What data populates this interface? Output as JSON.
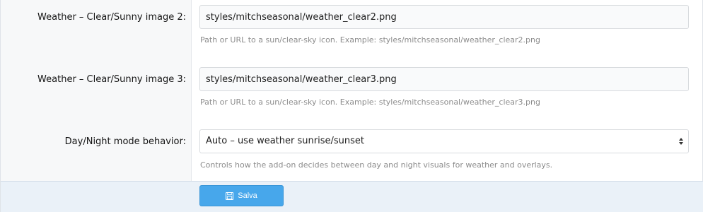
{
  "fields": [
    {
      "label": "Weather – Clear/Sunny image 2:",
      "value": "styles/mitchseasonal/weather_clear2.png",
      "hint": "Path or URL to a sun/clear-sky icon. Example: styles/mitchseasonal/weather_clear2.png"
    },
    {
      "label": "Weather – Clear/Sunny image 3:",
      "value": "styles/mitchseasonal/weather_clear3.png",
      "hint": "Path or URL to a sun/clear-sky icon. Example: styles/mitchseasonal/weather_clear3.png"
    }
  ],
  "day_night": {
    "label": "Day/Night mode behavior:",
    "selected": "Auto – use weather sunrise/sunset",
    "hint": "Controls how the add-on decides between day and night visuals for weather and overlays."
  },
  "footer": {
    "save_label": "Salva",
    "save_icon": "save-icon"
  },
  "colors": {
    "accent": "#47a7eb",
    "footer_bg": "#eaf1f8"
  }
}
